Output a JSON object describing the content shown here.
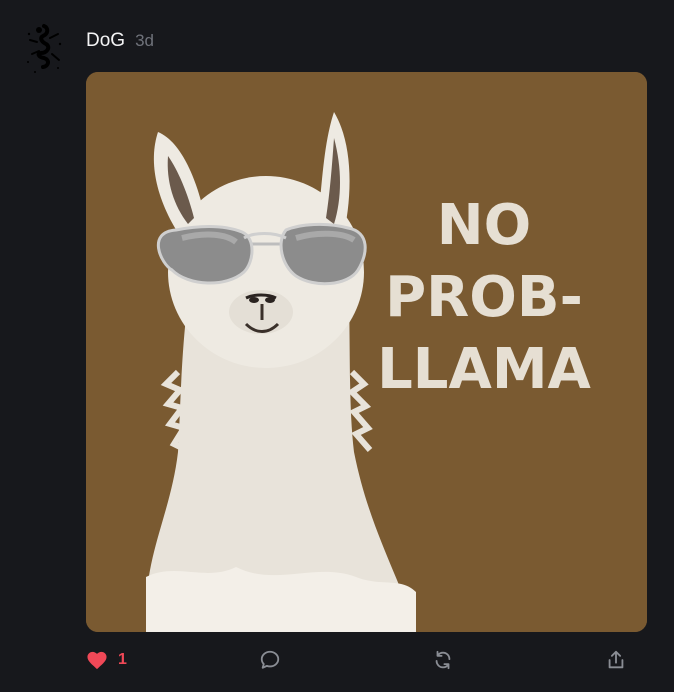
{
  "post": {
    "author": "DoG",
    "time_ago": "3d",
    "image_text": [
      "NO",
      "PROB-",
      "LLAMA"
    ]
  },
  "actions": {
    "like_count": "1",
    "liked": true
  },
  "colors": {
    "background": "#17181c",
    "like": "#f04857",
    "icon": "#8a8d94",
    "shirt": "#7a5a31",
    "print": "#e6dfd3"
  },
  "icons": [
    "heart-icon",
    "comment-icon",
    "repost-icon",
    "share-icon"
  ]
}
